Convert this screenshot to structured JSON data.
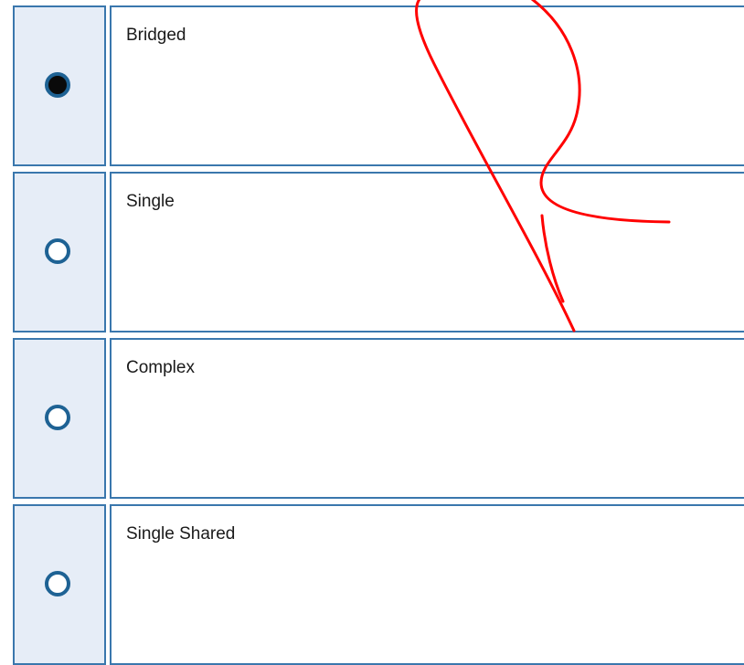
{
  "options": [
    {
      "label": "Bridged",
      "selected": true
    },
    {
      "label": "Single",
      "selected": false
    },
    {
      "label": "Complex",
      "selected": false
    },
    {
      "label": "Single Shared",
      "selected": false
    }
  ],
  "colors": {
    "border": "#3a77ad",
    "radio_cell_bg": "#e6edf7",
    "radio_ring": "#1e6294",
    "annotation": "#ff0000"
  }
}
